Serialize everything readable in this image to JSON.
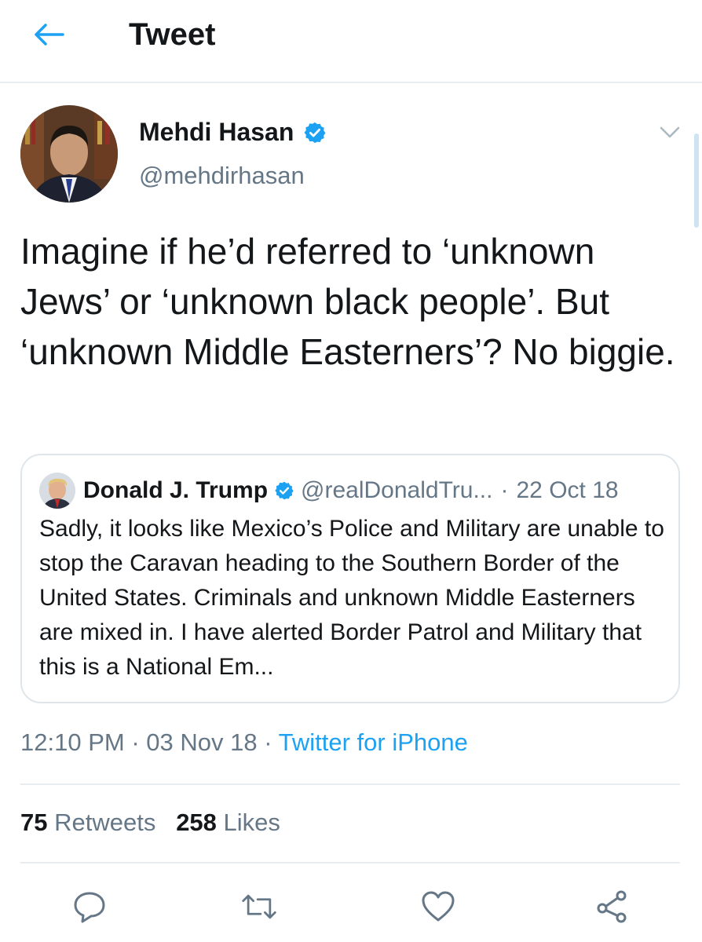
{
  "header": {
    "title": "Tweet",
    "back_icon": "back-arrow-icon"
  },
  "tweet": {
    "display_name": "Mehdi Hasan",
    "handle": "@mehdirhasan",
    "verified": true,
    "text": "Imagine if he’d referred to ‘unknown Jews’ or ‘unknown black people’. But ‘unknown Middle Easterners’? No biggie.",
    "time": "12:10 PM",
    "date": "03 Nov 18",
    "separator": "·",
    "source": "Twitter for iPhone",
    "retweets": {
      "count": "75",
      "label": "Retweets"
    },
    "likes": {
      "count": "258",
      "label": "Likes"
    }
  },
  "quoted_tweet": {
    "display_name": "Donald J. Trump",
    "handle": "@realDonaldTru...",
    "separator": "·",
    "date": "22 Oct 18",
    "verified": true,
    "text": "Sadly, it looks like Mexico’s Police and Military are unable to stop the Caravan heading to the Southern Border of the United States. Criminals and unknown Middle Easterners are mixed in. I have alerted Border Patrol and Military that this is a National Em..."
  },
  "actions": [
    "reply-icon",
    "retweet-icon",
    "like-icon",
    "share-icon"
  ],
  "colors": {
    "accent": "#1da1f2",
    "secondary_text": "#657786",
    "divider": "#e6ecf0",
    "primary_text": "#14171a"
  }
}
